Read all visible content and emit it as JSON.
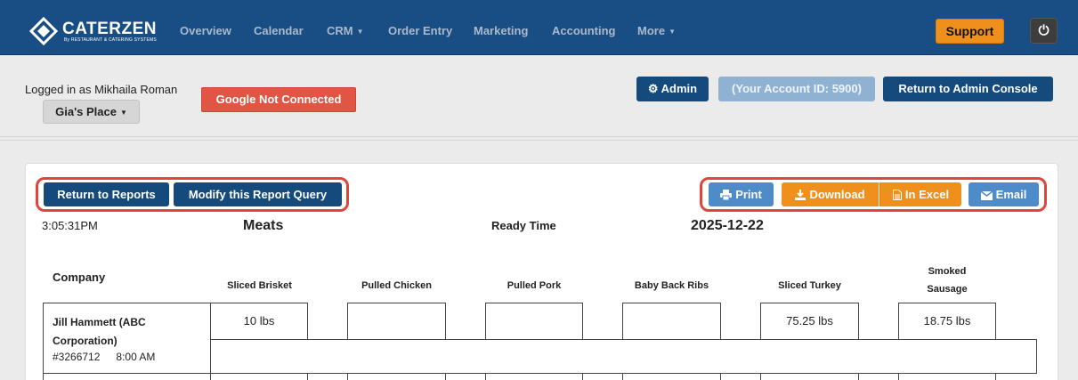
{
  "nav": {
    "logo_name": "CATERZEN",
    "logo_sub": "By RESTAURANT & CATERING SYSTEMS",
    "items": [
      "Overview",
      "Calendar",
      "CRM",
      "Order Entry",
      "Marketing",
      "Accounting",
      "More"
    ],
    "support_label": "Support",
    "power_icon": "⏻"
  },
  "header": {
    "logged_in_text": "Logged in as Mikhaila Roman",
    "place_label": "Gia's Place",
    "google_status": "Google Not Connected",
    "admin_label": "Admin",
    "account_label": "(Your Account ID: 5900)",
    "console_label": "Return to Admin Console"
  },
  "toolbar": {
    "return_label": "Return to Reports",
    "modify_label": "Modify this Report Query",
    "print_label": "Print",
    "download_label": "Download",
    "excel_label": "In Excel",
    "email_label": "Email"
  },
  "report": {
    "time": "3:05:31PM",
    "title": "Meats",
    "ready_label": "Ready Time",
    "date": "2025-12-22",
    "company_header": "Company",
    "columns": [
      "Sliced Brisket",
      "Pulled Chicken",
      "Pulled Pork",
      "Baby Back Ribs",
      "Sliced Turkey",
      "Smoked Sausage"
    ],
    "rows": [
      {
        "company": "Jill Hammett (ABC Corporation)",
        "order": "#3266712",
        "time": "8:00 AM",
        "values": [
          "10 lbs",
          "",
          "",
          "",
          "75.25 lbs",
          "18.75 lbs"
        ]
      }
    ]
  },
  "colors": {
    "nav_bg": "#184e84",
    "navy_button": "#154a7d",
    "light_blue_button": "#4d8bc9",
    "orange": "#f0901c",
    "danger": "#e05544",
    "highlight": "#e0473b"
  }
}
